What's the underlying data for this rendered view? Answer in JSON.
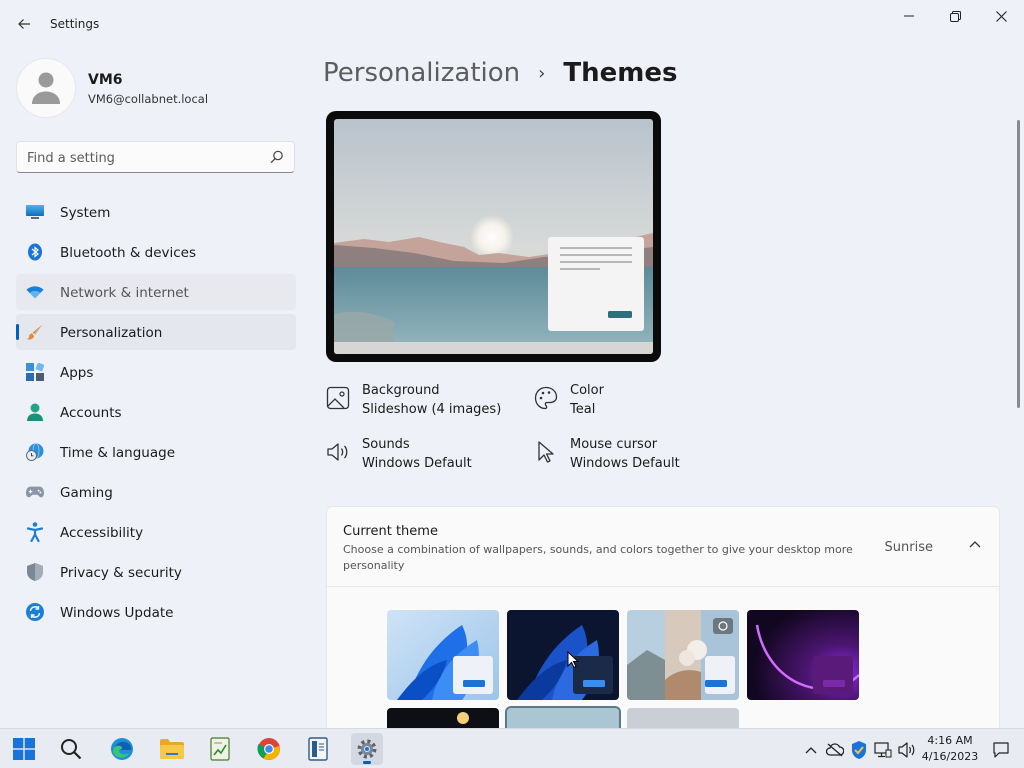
{
  "window": {
    "title": "Settings"
  },
  "profile": {
    "name": "VM6",
    "email": "VM6@collabnet.local"
  },
  "search": {
    "placeholder": "Find a setting"
  },
  "sidebar": {
    "items": [
      {
        "label": "System",
        "icon": "system-icon"
      },
      {
        "label": "Bluetooth & devices",
        "icon": "bluetooth-icon"
      },
      {
        "label": "Network & internet",
        "icon": "wifi-icon"
      },
      {
        "label": "Personalization",
        "icon": "paintbrush-icon"
      },
      {
        "label": "Apps",
        "icon": "apps-icon"
      },
      {
        "label": "Accounts",
        "icon": "person-icon"
      },
      {
        "label": "Time & language",
        "icon": "globe-clock-icon"
      },
      {
        "label": "Gaming",
        "icon": "gamepad-icon"
      },
      {
        "label": "Accessibility",
        "icon": "accessibility-icon"
      },
      {
        "label": "Privacy & security",
        "icon": "shield-icon"
      },
      {
        "label": "Windows Update",
        "icon": "update-icon"
      }
    ],
    "active_index": 3,
    "hover_index": 2
  },
  "breadcrumb": {
    "parent": "Personalization",
    "separator": "›",
    "current": "Themes"
  },
  "properties": {
    "background": {
      "title": "Background",
      "value": "Slideshow (4 images)"
    },
    "color": {
      "title": "Color",
      "value": "Teal"
    },
    "sounds": {
      "title": "Sounds",
      "value": "Windows Default"
    },
    "mouse_cursor": {
      "title": "Mouse cursor",
      "value": "Windows Default"
    }
  },
  "current_theme": {
    "title": "Current theme",
    "description": "Choose a combination of wallpapers, sounds, and colors together to give your desktop more personality",
    "value": "Sunrise",
    "themes": [
      "windows-light",
      "windows-dark",
      "spotlight",
      "glow",
      "captured-motion",
      "sunrise",
      "flow"
    ]
  },
  "taskbar": {
    "apps": [
      "start",
      "search",
      "edge",
      "file-explorer",
      "notepad-chart",
      "chrome",
      "reader",
      "settings"
    ],
    "active_app": "settings",
    "clock_time": "4:16 AM",
    "clock_date": "4/16/2023"
  },
  "colors": {
    "accent": "#005fb8",
    "background": "#eef1f7",
    "card": "#fafafa"
  }
}
